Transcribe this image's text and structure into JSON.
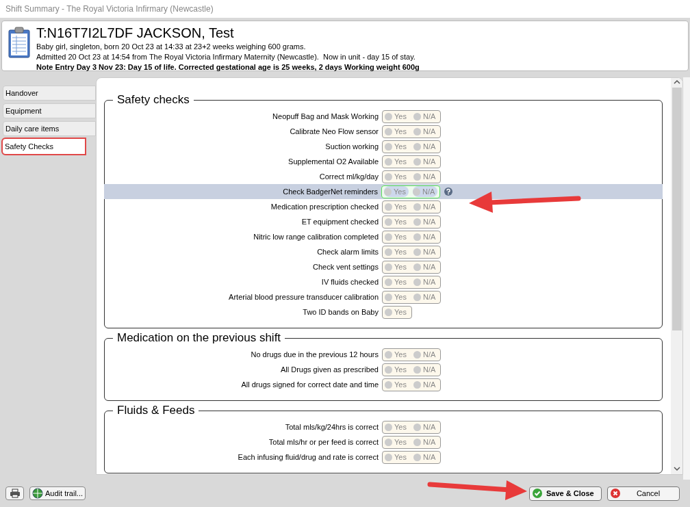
{
  "window": {
    "title": "Shift Summary - The Royal Victoria Infirmary (Newcastle)"
  },
  "patient": {
    "name": "T:N16T7I2L7DF JACKSON, Test",
    "lines": [
      "Baby girl, singleton, born 20 Oct 23 at 14:33 at 23+2 weeks weighing 600 grams.",
      "Admitted 20 Oct 23 at 14:54 from The Royal Victoria Infirmary Maternity (Newcastle).  Now in unit - day 15 of stay."
    ],
    "note": "Note Entry Day 3 Nov 23: Day 15 of life. Corrected gestational age is 25 weeks, 2 days Working weight 600g"
  },
  "sidebar": {
    "items": [
      {
        "label": "Handover",
        "selected": false
      },
      {
        "label": "Equipment",
        "selected": false
      },
      {
        "label": "Daily care items",
        "selected": false
      },
      {
        "label": "Safety Checks",
        "selected": true
      }
    ]
  },
  "sections": [
    {
      "title": "Safety checks",
      "rows": [
        {
          "label": "Neopuff Bag and Mask Working",
          "options": [
            {
              "label": "Yes",
              "selected": false
            },
            {
              "label": "N/A",
              "selected": false
            }
          ],
          "selected": false
        },
        {
          "label": "Calibrate Neo Flow sensor",
          "options": [
            {
              "label": "Yes",
              "selected": false
            },
            {
              "label": "N/A",
              "selected": false
            }
          ],
          "selected": false
        },
        {
          "label": "Suction working",
          "options": [
            {
              "label": "Yes",
              "selected": false
            },
            {
              "label": "N/A",
              "selected": false
            }
          ],
          "selected": false
        },
        {
          "label": "Supplemental O2 Available",
          "options": [
            {
              "label": "Yes",
              "selected": false
            },
            {
              "label": "N/A",
              "selected": false
            }
          ],
          "selected": false
        },
        {
          "label": "Correct ml/kg/day",
          "options": [
            {
              "label": "Yes",
              "selected": false
            },
            {
              "label": "N/A",
              "selected": false
            }
          ],
          "selected": false
        },
        {
          "label": "Check BadgerNet reminders",
          "options": [
            {
              "label": "Yes",
              "selected": false
            },
            {
              "label": "N/A",
              "selected": false
            }
          ],
          "selected": true
        },
        {
          "label": "Medication prescription checked",
          "options": [
            {
              "label": "Yes",
              "selected": false
            },
            {
              "label": "N/A",
              "selected": false
            }
          ],
          "selected": false
        },
        {
          "label": "ET equipment checked",
          "options": [
            {
              "label": "Yes",
              "selected": false
            },
            {
              "label": "N/A",
              "selected": false
            }
          ],
          "selected": false
        },
        {
          "label": "Nitric low range calibration completed",
          "options": [
            {
              "label": "Yes",
              "selected": false
            },
            {
              "label": "N/A",
              "selected": false
            }
          ],
          "selected": false
        },
        {
          "label": "Check alarm limits",
          "options": [
            {
              "label": "Yes",
              "selected": false
            },
            {
              "label": "N/A",
              "selected": false
            }
          ],
          "selected": false
        },
        {
          "label": "Check vent settings",
          "options": [
            {
              "label": "Yes",
              "selected": false
            },
            {
              "label": "N/A",
              "selected": false
            }
          ],
          "selected": false
        },
        {
          "label": "IV fluids checked",
          "options": [
            {
              "label": "Yes",
              "selected": false
            },
            {
              "label": "N/A",
              "selected": false
            }
          ],
          "selected": false
        },
        {
          "label": "Arterial blood pressure transducer calibration",
          "options": [
            {
              "label": "Yes",
              "selected": false
            },
            {
              "label": "N/A",
              "selected": false
            }
          ],
          "selected": false
        },
        {
          "label": "Two ID bands on Baby",
          "options": [
            {
              "label": "Yes",
              "selected": false
            }
          ],
          "selected": false
        }
      ]
    },
    {
      "title": "Medication on the previous shift",
      "rows": [
        {
          "label": "No drugs due in the previous 12 hours",
          "options": [
            {
              "label": "Yes",
              "selected": false
            },
            {
              "label": "N/A",
              "selected": false
            }
          ],
          "selected": false
        },
        {
          "label": "All Drugs given as prescribed",
          "options": [
            {
              "label": "Yes",
              "selected": false
            },
            {
              "label": "N/A",
              "selected": false
            }
          ],
          "selected": false
        },
        {
          "label": "All drugs signed for correct date and time",
          "options": [
            {
              "label": "Yes",
              "selected": false
            },
            {
              "label": "N/A",
              "selected": false
            }
          ],
          "selected": false
        }
      ]
    },
    {
      "title": "Fluids & Feeds",
      "rows": [
        {
          "label": "Total mls/kg/24hrs is correct",
          "options": [
            {
              "label": "Yes",
              "selected": false
            },
            {
              "label": "N/A",
              "selected": false
            }
          ],
          "selected": false
        },
        {
          "label": "Total mls/hr or per feed is correct",
          "options": [
            {
              "label": "Yes",
              "selected": false
            },
            {
              "label": "N/A",
              "selected": false
            }
          ],
          "selected": false
        },
        {
          "label": "Each infusing fluid/drug and rate is correct",
          "options": [
            {
              "label": "Yes",
              "selected": false
            },
            {
              "label": "N/A",
              "selected": false
            }
          ],
          "selected": false
        }
      ]
    }
  ],
  "footer": {
    "audit": "Audit trail...",
    "save": "Save & Close",
    "cancel": "Cancel"
  }
}
